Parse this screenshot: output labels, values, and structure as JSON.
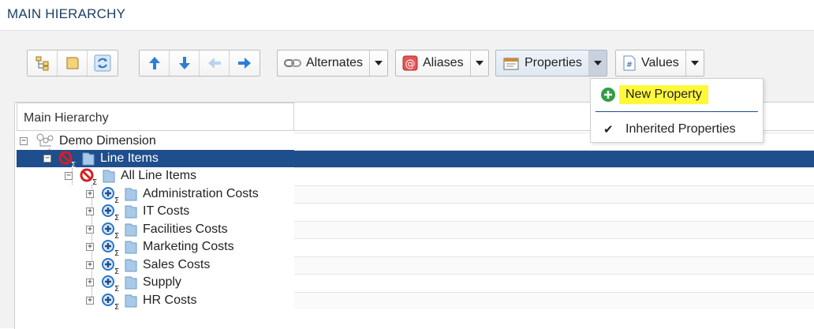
{
  "page": {
    "title": "MAIN HIERARCHY"
  },
  "toolbar": {
    "alternates_label": "Alternates",
    "aliases_label": "Aliases",
    "properties_label": "Properties",
    "values_label": "Values"
  },
  "dropdown": {
    "new_property": "New Property",
    "inherited_properties": "Inherited Properties"
  },
  "grid": {
    "column_header": "Main Hierarchy",
    "rows": [
      {
        "label": "Demo Dimension"
      },
      {
        "label": "Line Items"
      },
      {
        "label": "All Line Items"
      },
      {
        "label": "Administration Costs"
      },
      {
        "label": "IT Costs"
      },
      {
        "label": "Facilities Costs"
      },
      {
        "label": "Marketing Costs"
      },
      {
        "label": "Sales Costs"
      },
      {
        "label": "Supply"
      },
      {
        "label": "HR Costs"
      }
    ]
  },
  "colors": {
    "selection": "#1f4e8c",
    "title": "#1e3f66",
    "highlight": "#fff83a",
    "add_green": "#2ea043"
  }
}
